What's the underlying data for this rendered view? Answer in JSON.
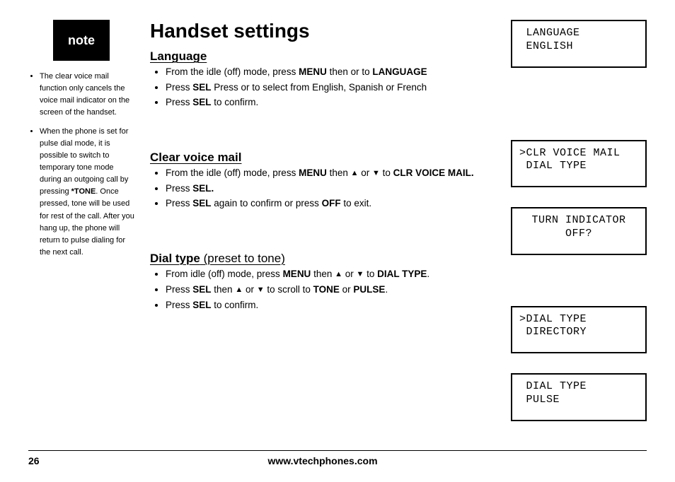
{
  "sidebar": {
    "badge": "note",
    "notes": {
      "n1": "The clear voice mail function only cancels the voice mail indicator on the screen of the handset.",
      "n2_a": "When the phone is set for pulse dial mode, it is possible to switch to temporary tone mode during an outgoing call by pressing ",
      "n2_bold": "*TONE",
      "n2_b": ". Once pressed, tone will be used for rest of the call. After you hang up, the phone will return to pulse dialing for the next call."
    }
  },
  "main": {
    "title": "Handset settings",
    "language": {
      "heading": "Language",
      "b1_a": "From the idle (off) mode, press ",
      "b1_menu": "MENU",
      "b1_b": " then or to ",
      "b1_lang": "LANGUAGE",
      "b2_a": "Press ",
      "b2_sel": "SEL",
      "b2_b": " Press or to select from English, Spanish or French",
      "b3_a": "Press ",
      "b3_sel": "SEL",
      "b3_b": " to confirm."
    },
    "clear": {
      "heading": "Clear voice mail",
      "b1_a": "From the idle (off) mode, press ",
      "b1_menu": "MENU",
      "b1_b": " then  ",
      "b1_or": "  or ",
      "b1_to": " to ",
      "b1_clr": "CLR VOICE MAIL.",
      "b2_a": "Press ",
      "b2_sel": "SEL.",
      "b3_a": "Press ",
      "b3_sel": "SEL",
      "b3_b": " again to confirm or press ",
      "b3_off": "OFF",
      "b3_c": " to exit."
    },
    "dial": {
      "heading_strong": "Dial type",
      "heading_rest": " (preset to tone)",
      "b1_a": "From idle (off) mode, press ",
      "b1_menu": "MENU",
      "b1_b": " then ",
      "b1_or": "  or ",
      "b1_to": " to ",
      "b1_dt": "DIAL TYPE",
      "b1_dot": ".",
      "b2_a": "Press ",
      "b2_sel": "SEL",
      "b2_b": " then ",
      "b2_or": " or ",
      "b2_c": " to scroll to ",
      "b2_tone": "TONE",
      "b2_or2": " or ",
      "b2_pulse": "PULSE",
      "b2_dot": ".",
      "b3_a": "Press ",
      "b3_sel": "SEL",
      "b3_b": " to confirm."
    }
  },
  "lcd": {
    "l1": " LANGUAGE\n ENGLISH",
    "l2": ">CLR VOICE MAIL\n DIAL TYPE",
    "l3": "TURN INDICATOR\nOFF?",
    "l4": ">DIAL TYPE\n DIRECTORY",
    "l5": " DIAL TYPE\n PULSE"
  },
  "footer": {
    "page": "26",
    "url": "www.vtechphones.com"
  },
  "glyphs": {
    "up": "▲",
    "down": "▼"
  }
}
